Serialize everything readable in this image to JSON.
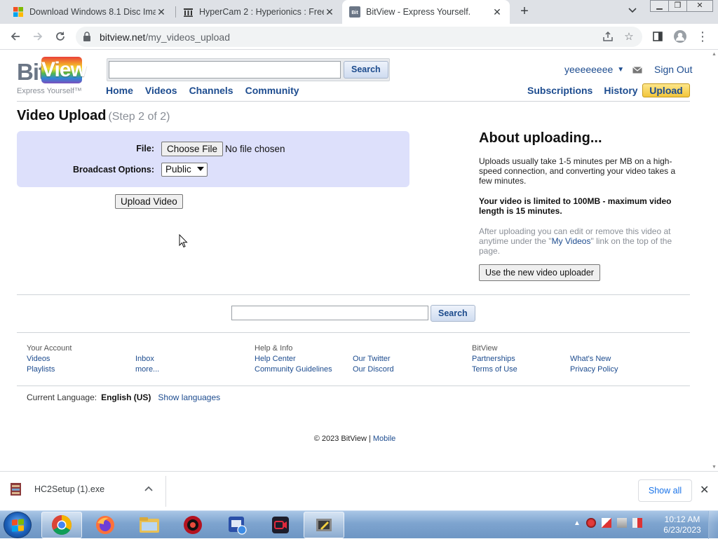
{
  "browser": {
    "tabs": [
      {
        "title": "Download Windows 8.1 Disc Ima",
        "active": false
      },
      {
        "title": "HyperCam 2 : Hyperionics : Free",
        "active": false
      },
      {
        "title": "BitView - Express Yourself.",
        "active": true
      }
    ],
    "url_domain": "bitview.net",
    "url_path": "/my_videos_upload"
  },
  "site": {
    "logo_left": "Bit",
    "logo_right": "View",
    "tagline": "Express Yourself™",
    "search_button": "Search",
    "nav": [
      "Home",
      "Videos",
      "Channels",
      "Community"
    ],
    "username": "yeeeeeeee",
    "sign_out": "Sign Out",
    "right_nav": [
      "Subscriptions",
      "History"
    ],
    "upload_button": "Upload"
  },
  "upload": {
    "title": "Video Upload",
    "step": "(Step 2 of 2)",
    "file_label": "File:",
    "choose_file": "Choose File",
    "no_file": "No file chosen",
    "broadcast_label": "Broadcast Options:",
    "broadcast_value": "Public",
    "upload_video_button": "Upload Video"
  },
  "about": {
    "heading": "About uploading...",
    "p1": "Uploads usually take 1-5 minutes per MB on a high-speed connection, and converting your video takes a few minutes.",
    "p2": "Your video is limited to 100MB - maximum video length is 15 minutes.",
    "p3_before": "After uploading you can edit or remove this video at anytime under the \"",
    "p3_link": "My Videos",
    "p3_after": "\" link on the top of the page.",
    "new_uploader_button": "Use the new video uploader"
  },
  "footer": {
    "search_button": "Search",
    "columns": [
      {
        "head": "Your Account",
        "links": [
          "Videos",
          "Playlists"
        ]
      },
      {
        "head": "",
        "links": [
          "Inbox",
          "more..."
        ]
      },
      {
        "head": "Help & Info",
        "links": [
          "Help Center",
          "Community Guidelines"
        ]
      },
      {
        "head": "",
        "links": [
          "Our Twitter",
          "Our Discord"
        ]
      },
      {
        "head": "BitView",
        "links": [
          "Partnerships",
          "Terms of Use"
        ]
      },
      {
        "head": "",
        "links": [
          "What's New",
          "Privacy Policy"
        ]
      }
    ],
    "language_label": "Current Language:",
    "language_value": "English (US)",
    "show_languages": "Show languages",
    "copyright": "© 2023 BitView |",
    "mobile": "Mobile"
  },
  "downloads": {
    "file_name": "HC2Setup (1).exe",
    "show_all": "Show all"
  },
  "taskbar": {
    "time": "10:12 AM",
    "date": "6/23/2023"
  },
  "colors": {
    "link_blue": "#1d4c8f",
    "upload_box_bg": "#dde0fb",
    "upload_button_bg": "#f2c63b"
  }
}
